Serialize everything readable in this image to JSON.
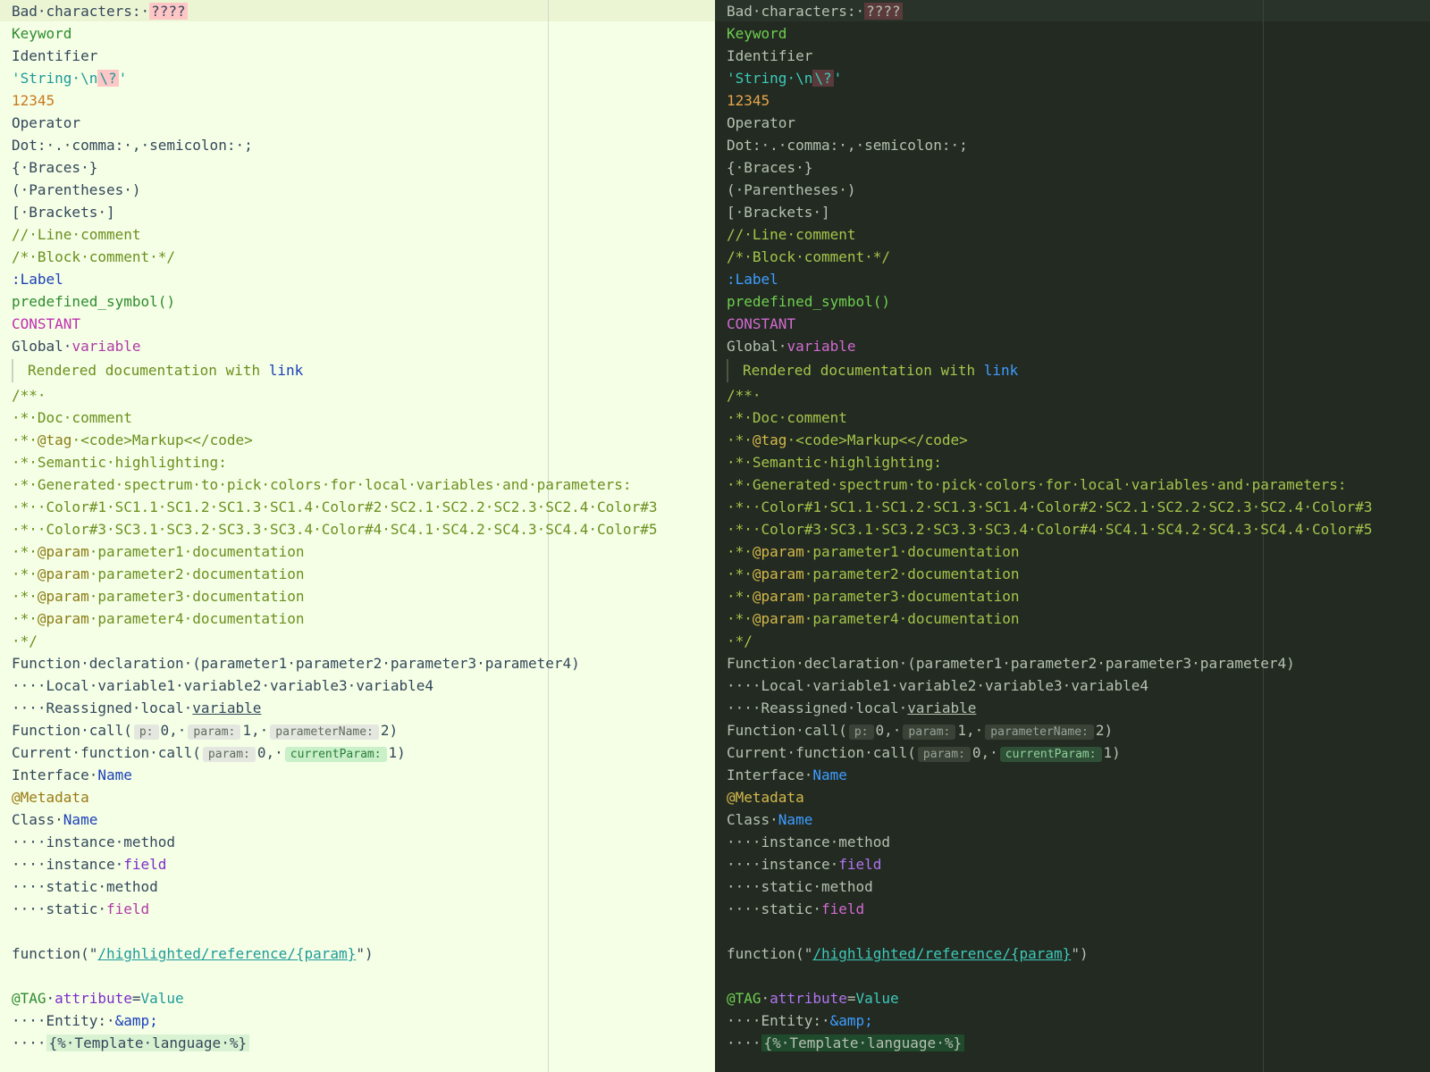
{
  "panes": [
    {
      "theme": "light"
    },
    {
      "theme": "dark"
    }
  ],
  "lines": {
    "bad_label": "Bad·characters:·",
    "bad_value": "????",
    "keyword": "Keyword",
    "identifier": "Identifier",
    "string_pre": "'String·\\n",
    "string_bad": "\\?",
    "string_post": "'",
    "number": "12345",
    "operator": "Operator",
    "punct": "Dot:·.·comma:·,·semicolon:·;",
    "braces": "{·Braces·}",
    "parens": "(·Parentheses·)",
    "brackets": "[·Brackets·]",
    "line_comment": "//·Line·comment",
    "block_comment": "/*·Block·comment·*/",
    "label": ":Label",
    "predefined": "predefined_symbol()",
    "constant": "CONSTANT",
    "global_pre": "Global·",
    "global_var": "variable",
    "rendered_doc": "Rendered documentation with ",
    "rendered_link": "link",
    "doc_open": "/**·",
    "doc_line1": "·*·Doc·comment",
    "doc_tag_prefix": "·*·",
    "doc_tag": "@tag",
    "doc_tag_rest": "·<code>Markup<</code>",
    "doc_semantic": "·*·Semantic·highlighting:",
    "doc_generated": "·*·Generated·spectrum·to·pick·colors·for·local·variables·and·parameters:",
    "doc_colors1": "·*··Color#1·SC1.1·SC1.2·SC1.3·SC1.4·Color#2·SC2.1·SC2.2·SC2.3·SC2.4·Color#3",
    "doc_colors2": "·*··Color#3·SC3.1·SC3.2·SC3.3·SC3.4·Color#4·SC4.1·SC4.2·SC4.3·SC4.4·Color#5",
    "param_tag": "@param",
    "params": [
      "·parameter1·documentation",
      "·parameter2·documentation",
      "·parameter3·documentation",
      "·parameter4·documentation"
    ],
    "doc_close": "·*/",
    "func_decl": "Function·declaration·(parameter1·parameter2·parameter3·parameter4)",
    "local_vars": "····Local·variable1·variable2·variable3·variable4",
    "reassigned_pre": "····Reassigned·local·",
    "reassigned_var": "variable",
    "call_pre": "Function·call(",
    "hint_p": "p:",
    "hint_param": "param:",
    "hint_paramName": "parameterName:",
    "hint_currentParam": "currentParam:",
    "call_v0": "0,·",
    "call_v1": "1,·",
    "call_v2": "2)",
    "curcall_pre": "Current·function·call(",
    "curcall_v1": "1)",
    "interface_pre": "Interface·",
    "name": "Name",
    "metadata": "@Metadata",
    "class_pre": "Class·",
    "instance_method": "····instance·method",
    "instance_field_pre": "····instance·",
    "field": "field",
    "static_method": "····static·method",
    "static_field_pre": "····static·",
    "func_string_pre": "function(\"",
    "func_string_ref": "/highlighted/reference/{param}",
    "func_string_post": "\")",
    "tag": "@TAG",
    "attribute": "attribute",
    "attr_eq": "=",
    "attr_value": "Value",
    "entity_pre": "····Entity:·",
    "entity": "&amp;",
    "template_indent": "····",
    "template": "{%·Template·language·%}"
  }
}
